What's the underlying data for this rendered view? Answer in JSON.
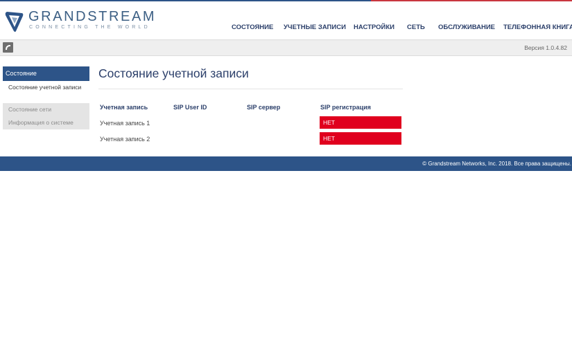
{
  "brand": {
    "name": "GRANDSTREAM",
    "tagline": "CONNECTING THE WORLD"
  },
  "nav": {
    "status": "СОСТОЯНИЕ",
    "accounts": "УЧЕТНЫЕ ЗАПИСИ",
    "settings": "НАСТРОЙКИ",
    "network": "СЕТЬ",
    "maintenance": "ОБСЛУЖИВАНИЕ",
    "phonebook": "ТЕЛЕФОННАЯ КНИГА"
  },
  "version": "Версия 1.0.4.82",
  "sidebar": {
    "header": "Состояние",
    "items": [
      {
        "label": "Состояние учетной записи"
      },
      {
        "label": "Состояние сети"
      },
      {
        "label": "Информация о системе"
      }
    ]
  },
  "page": {
    "title": "Состояние учетной записи"
  },
  "table": {
    "headers": [
      "Учетная запись",
      "SIP User ID",
      "SIP сервер",
      "SIP регистрация"
    ],
    "rows": [
      {
        "account": "Учетная запись 1",
        "user_id": "",
        "server": "",
        "registration": "НЕТ"
      },
      {
        "account": "Учетная запись 2",
        "user_id": "",
        "server": "",
        "registration": "НЕТ"
      }
    ]
  },
  "footer": {
    "copyright": "© Grandstream Networks, Inc. 2018. Все права защищены."
  },
  "colors": {
    "primary": "#2d5488",
    "alert": "#e0001e",
    "accent_red": "#c9363f"
  }
}
